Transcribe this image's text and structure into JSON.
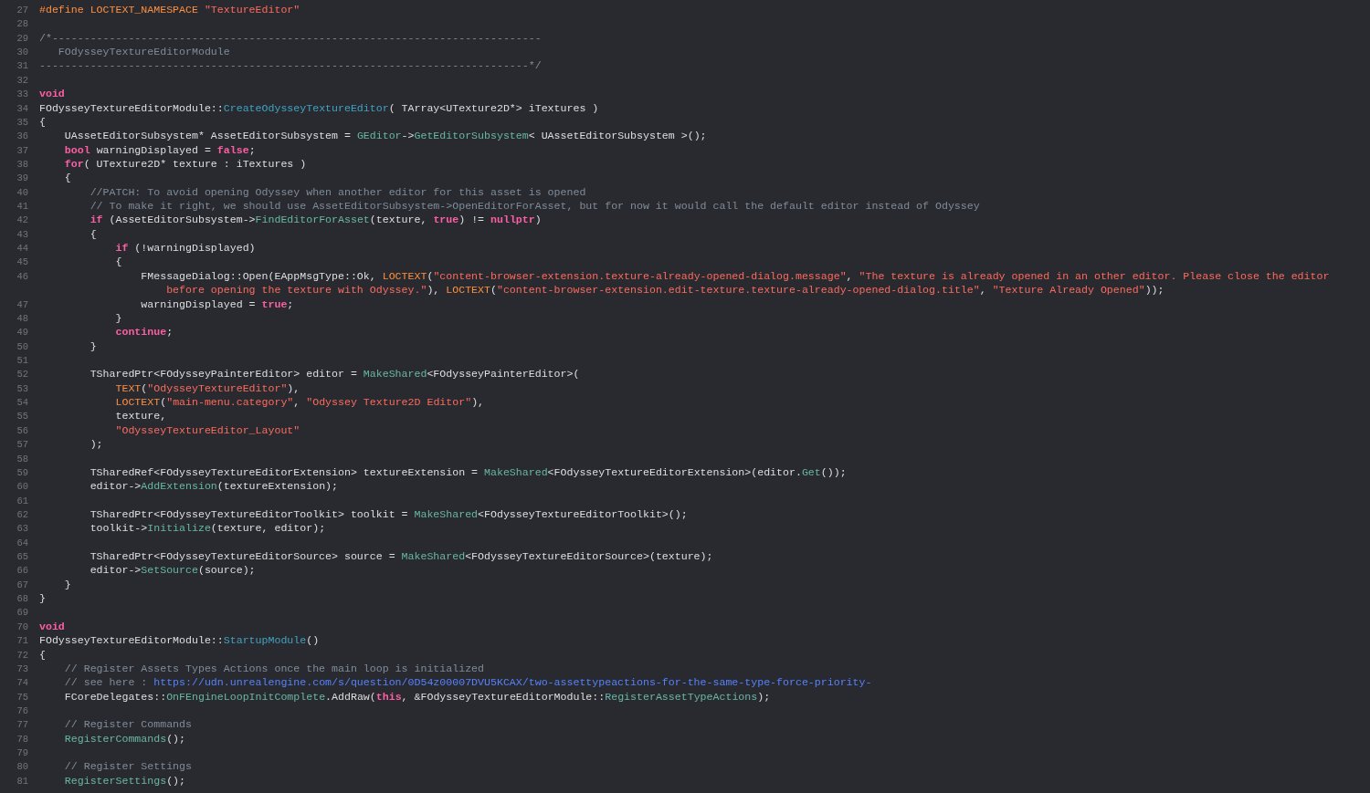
{
  "editor": {
    "lines": [
      {
        "number": "27",
        "segments": [
          {
            "text": "#define LOCTEXT_NAMESPACE ",
            "kind": "preproc"
          },
          {
            "text": "\"TextureEditor\"",
            "kind": "string"
          }
        ]
      },
      {
        "number": "28"
      },
      {
        "number": "29",
        "segments": [
          {
            "text": "/*-----------------------------------------------------------------------------",
            "kind": "comment"
          }
        ]
      },
      {
        "number": "30",
        "segments": [
          {
            "text": "   FOdysseyTextureEditorModule",
            "kind": "comment"
          }
        ]
      },
      {
        "number": "31",
        "segments": [
          {
            "text": "-----------------------------------------------------------------------------*/",
            "kind": "comment"
          }
        ]
      },
      {
        "number": "32"
      },
      {
        "number": "33",
        "segments": [
          {
            "text": "void",
            "kind": "keyword"
          }
        ]
      },
      {
        "number": "34",
        "segments": [
          {
            "text": "FOdysseyTextureEditorModule::",
            "kind": "plain"
          },
          {
            "text": "CreateOdysseyTextureEditor",
            "kind": "declaration"
          },
          {
            "text": "( TArray<UTexture2D*> iTextures )",
            "kind": "plain"
          }
        ]
      },
      {
        "number": "35",
        "segments": [
          {
            "text": "{",
            "kind": "plain"
          }
        ]
      },
      {
        "number": "36",
        "segments": [
          {
            "text": "    UAssetEditorSubsystem* AssetEditorSubsystem = ",
            "kind": "plain"
          },
          {
            "text": "GEditor",
            "kind": "function"
          },
          {
            "text": "->",
            "kind": "plain"
          },
          {
            "text": "GetEditorSubsystem",
            "kind": "function"
          },
          {
            "text": "< UAssetEditorSubsystem >();",
            "kind": "plain"
          }
        ]
      },
      {
        "number": "37",
        "segments": [
          {
            "text": "    bool",
            "kind": "keyword"
          },
          {
            "text": " warningDisplayed = ",
            "kind": "plain"
          },
          {
            "text": "false",
            "kind": "keyword"
          },
          {
            "text": ";",
            "kind": "plain"
          }
        ]
      },
      {
        "number": "38",
        "segments": [
          {
            "text": "    for",
            "kind": "keyword"
          },
          {
            "text": "( UTexture2D* texture : iTextures )",
            "kind": "plain"
          }
        ]
      },
      {
        "number": "39",
        "segments": [
          {
            "text": "    {",
            "kind": "plain"
          }
        ]
      },
      {
        "number": "40",
        "segments": [
          {
            "text": "        //PATCH: To avoid opening Odyssey when another editor for this asset is opened",
            "kind": "comment"
          }
        ]
      },
      {
        "number": "41",
        "segments": [
          {
            "text": "        // To make it right, we should use AssetEditorSubsystem->OpenEditorForAsset, but for now it would call the default editor instead of Odyssey",
            "kind": "comment"
          }
        ]
      },
      {
        "number": "42",
        "segments": [
          {
            "text": "        if",
            "kind": "keyword"
          },
          {
            "text": " (AssetEditorSubsystem->",
            "kind": "plain"
          },
          {
            "text": "FindEditorForAsset",
            "kind": "function"
          },
          {
            "text": "(texture, ",
            "kind": "plain"
          },
          {
            "text": "true",
            "kind": "keyword"
          },
          {
            "text": ") != ",
            "kind": "plain"
          },
          {
            "text": "nullptr",
            "kind": "keyword"
          },
          {
            "text": ")",
            "kind": "plain"
          }
        ]
      },
      {
        "number": "43",
        "segments": [
          {
            "text": "        {",
            "kind": "plain"
          }
        ]
      },
      {
        "number": "44",
        "segments": [
          {
            "text": "            if",
            "kind": "keyword"
          },
          {
            "text": " (!warningDisplayed)",
            "kind": "plain"
          }
        ]
      },
      {
        "number": "45",
        "segments": [
          {
            "text": "            {",
            "kind": "plain"
          }
        ]
      },
      {
        "number": "46",
        "segments": [
          {
            "text": "                FMessageDialog::Open(EAppMsgType::Ok, ",
            "kind": "plain"
          },
          {
            "text": "LOCTEXT",
            "kind": "preproc"
          },
          {
            "text": "(",
            "kind": "plain"
          },
          {
            "text": "\"content-browser-extension.texture-already-opened-dialog.message\"",
            "kind": "string"
          },
          {
            "text": ", ",
            "kind": "plain"
          },
          {
            "text": "\"The texture is already opened in an other editor. Please close the editor",
            "kind": "string"
          }
        ]
      },
      {
        "segments": [
          {
            "text": "                    before opening the texture with Odyssey.\"",
            "kind": "string"
          },
          {
            "text": "), ",
            "kind": "plain"
          },
          {
            "text": "LOCTEXT",
            "kind": "preproc"
          },
          {
            "text": "(",
            "kind": "plain"
          },
          {
            "text": "\"content-browser-extension.edit-texture.texture-already-opened-dialog.title\"",
            "kind": "string"
          },
          {
            "text": ", ",
            "kind": "plain"
          },
          {
            "text": "\"Texture Already Opened\"",
            "kind": "string"
          },
          {
            "text": "));",
            "kind": "plain"
          }
        ]
      },
      {
        "number": "47",
        "segments": [
          {
            "text": "                warningDisplayed = ",
            "kind": "plain"
          },
          {
            "text": "true",
            "kind": "keyword"
          },
          {
            "text": ";",
            "kind": "plain"
          }
        ]
      },
      {
        "number": "48",
        "segments": [
          {
            "text": "            }",
            "kind": "plain"
          }
        ]
      },
      {
        "number": "49",
        "segments": [
          {
            "text": "            continue",
            "kind": "keyword"
          },
          {
            "text": ";",
            "kind": "plain"
          }
        ]
      },
      {
        "number": "50",
        "segments": [
          {
            "text": "        }",
            "kind": "plain"
          }
        ]
      },
      {
        "number": "51"
      },
      {
        "number": "52",
        "segments": [
          {
            "text": "        TSharedPtr<FOdysseyPainterEditor> editor = ",
            "kind": "plain"
          },
          {
            "text": "MakeShared",
            "kind": "function"
          },
          {
            "text": "<FOdysseyPainterEditor>(",
            "kind": "plain"
          }
        ]
      },
      {
        "number": "53",
        "segments": [
          {
            "text": "            TEXT",
            "kind": "preproc"
          },
          {
            "text": "(",
            "kind": "plain"
          },
          {
            "text": "\"OdysseyTextureEditor\"",
            "kind": "string"
          },
          {
            "text": "),",
            "kind": "plain"
          }
        ]
      },
      {
        "number": "54",
        "segments": [
          {
            "text": "            LOCTEXT",
            "kind": "preproc"
          },
          {
            "text": "(",
            "kind": "plain"
          },
          {
            "text": "\"main-menu.category\"",
            "kind": "string"
          },
          {
            "text": ", ",
            "kind": "plain"
          },
          {
            "text": "\"Odyssey Texture2D Editor\"",
            "kind": "string"
          },
          {
            "text": "),",
            "kind": "plain"
          }
        ]
      },
      {
        "number": "55",
        "segments": [
          {
            "text": "            texture,",
            "kind": "plain"
          }
        ]
      },
      {
        "number": "56",
        "segments": [
          {
            "text": "            \"OdysseyTextureEditor_Layout\"",
            "kind": "string"
          }
        ]
      },
      {
        "number": "57",
        "segments": [
          {
            "text": "        );",
            "kind": "plain"
          }
        ]
      },
      {
        "number": "58"
      },
      {
        "number": "59",
        "segments": [
          {
            "text": "        TSharedRef<FOdysseyTextureEditorExtension> textureExtension = ",
            "kind": "plain"
          },
          {
            "text": "MakeShared",
            "kind": "function"
          },
          {
            "text": "<FOdysseyTextureEditorExtension>(editor.",
            "kind": "plain"
          },
          {
            "text": "Get",
            "kind": "function"
          },
          {
            "text": "());",
            "kind": "plain"
          }
        ]
      },
      {
        "number": "60",
        "segments": [
          {
            "text": "        editor->",
            "kind": "plain"
          },
          {
            "text": "AddExtension",
            "kind": "function"
          },
          {
            "text": "(textureExtension);",
            "kind": "plain"
          }
        ]
      },
      {
        "number": "61"
      },
      {
        "number": "62",
        "segments": [
          {
            "text": "        TSharedPtr<FOdysseyTextureEditorToolkit> toolkit = ",
            "kind": "plain"
          },
          {
            "text": "MakeShared",
            "kind": "function"
          },
          {
            "text": "<FOdysseyTextureEditorToolkit>();",
            "kind": "plain"
          }
        ]
      },
      {
        "number": "63",
        "segments": [
          {
            "text": "        toolkit->",
            "kind": "plain"
          },
          {
            "text": "Initialize",
            "kind": "function"
          },
          {
            "text": "(texture, editor);",
            "kind": "plain"
          }
        ]
      },
      {
        "number": "64"
      },
      {
        "number": "65",
        "segments": [
          {
            "text": "        TSharedPtr<FOdysseyTextureEditorSource> source = ",
            "kind": "plain"
          },
          {
            "text": "MakeShared",
            "kind": "function"
          },
          {
            "text": "<FOdysseyTextureEditorSource>(texture);",
            "kind": "plain"
          }
        ]
      },
      {
        "number": "66",
        "segments": [
          {
            "text": "        editor->",
            "kind": "plain"
          },
          {
            "text": "SetSource",
            "kind": "function"
          },
          {
            "text": "(source);",
            "kind": "plain"
          }
        ]
      },
      {
        "number": "67",
        "segments": [
          {
            "text": "    }",
            "kind": "plain"
          }
        ]
      },
      {
        "number": "68",
        "segments": [
          {
            "text": "}",
            "kind": "plain"
          }
        ]
      },
      {
        "number": "69"
      },
      {
        "number": "70",
        "segments": [
          {
            "text": "void",
            "kind": "keyword"
          }
        ]
      },
      {
        "number": "71",
        "segments": [
          {
            "text": "FOdysseyTextureEditorModule::",
            "kind": "plain"
          },
          {
            "text": "StartupModule",
            "kind": "declaration"
          },
          {
            "text": "()",
            "kind": "plain"
          }
        ]
      },
      {
        "number": "72",
        "segments": [
          {
            "text": "{",
            "kind": "plain"
          }
        ]
      },
      {
        "number": "73",
        "segments": [
          {
            "text": "    // Register Assets Types Actions once the main loop is initialized",
            "kind": "comment"
          }
        ]
      },
      {
        "number": "74",
        "segments": [
          {
            "text": "    // see here : ",
            "kind": "comment"
          },
          {
            "text": "https://udn.unrealengine.com/s/question/0D54z00007DVU5KCAX/two-assettypeactions-for-the-same-type-force-priority-",
            "kind": "link"
          }
        ]
      },
      {
        "number": "75",
        "segments": [
          {
            "text": "    FCoreDelegates::",
            "kind": "plain"
          },
          {
            "text": "OnFEngineLoopInitComplete",
            "kind": "function"
          },
          {
            "text": ".AddRaw(",
            "kind": "plain"
          },
          {
            "text": "this",
            "kind": "keyword"
          },
          {
            "text": ", &FOdysseyTextureEditorModule::",
            "kind": "plain"
          },
          {
            "text": "RegisterAssetTypeActions",
            "kind": "function"
          },
          {
            "text": ");",
            "kind": "plain"
          }
        ]
      },
      {
        "number": "76"
      },
      {
        "number": "77",
        "segments": [
          {
            "text": "    // Register Commands",
            "kind": "comment"
          }
        ]
      },
      {
        "number": "78",
        "segments": [
          {
            "text": "    RegisterCommands",
            "kind": "function"
          },
          {
            "text": "();",
            "kind": "plain"
          }
        ]
      },
      {
        "number": "79"
      },
      {
        "number": "80",
        "segments": [
          {
            "text": "    // Register Settings",
            "kind": "comment"
          }
        ]
      },
      {
        "number": "81",
        "segments": [
          {
            "text": "    RegisterSettings",
            "kind": "function"
          },
          {
            "text": "();",
            "kind": "plain"
          }
        ]
      }
    ]
  }
}
